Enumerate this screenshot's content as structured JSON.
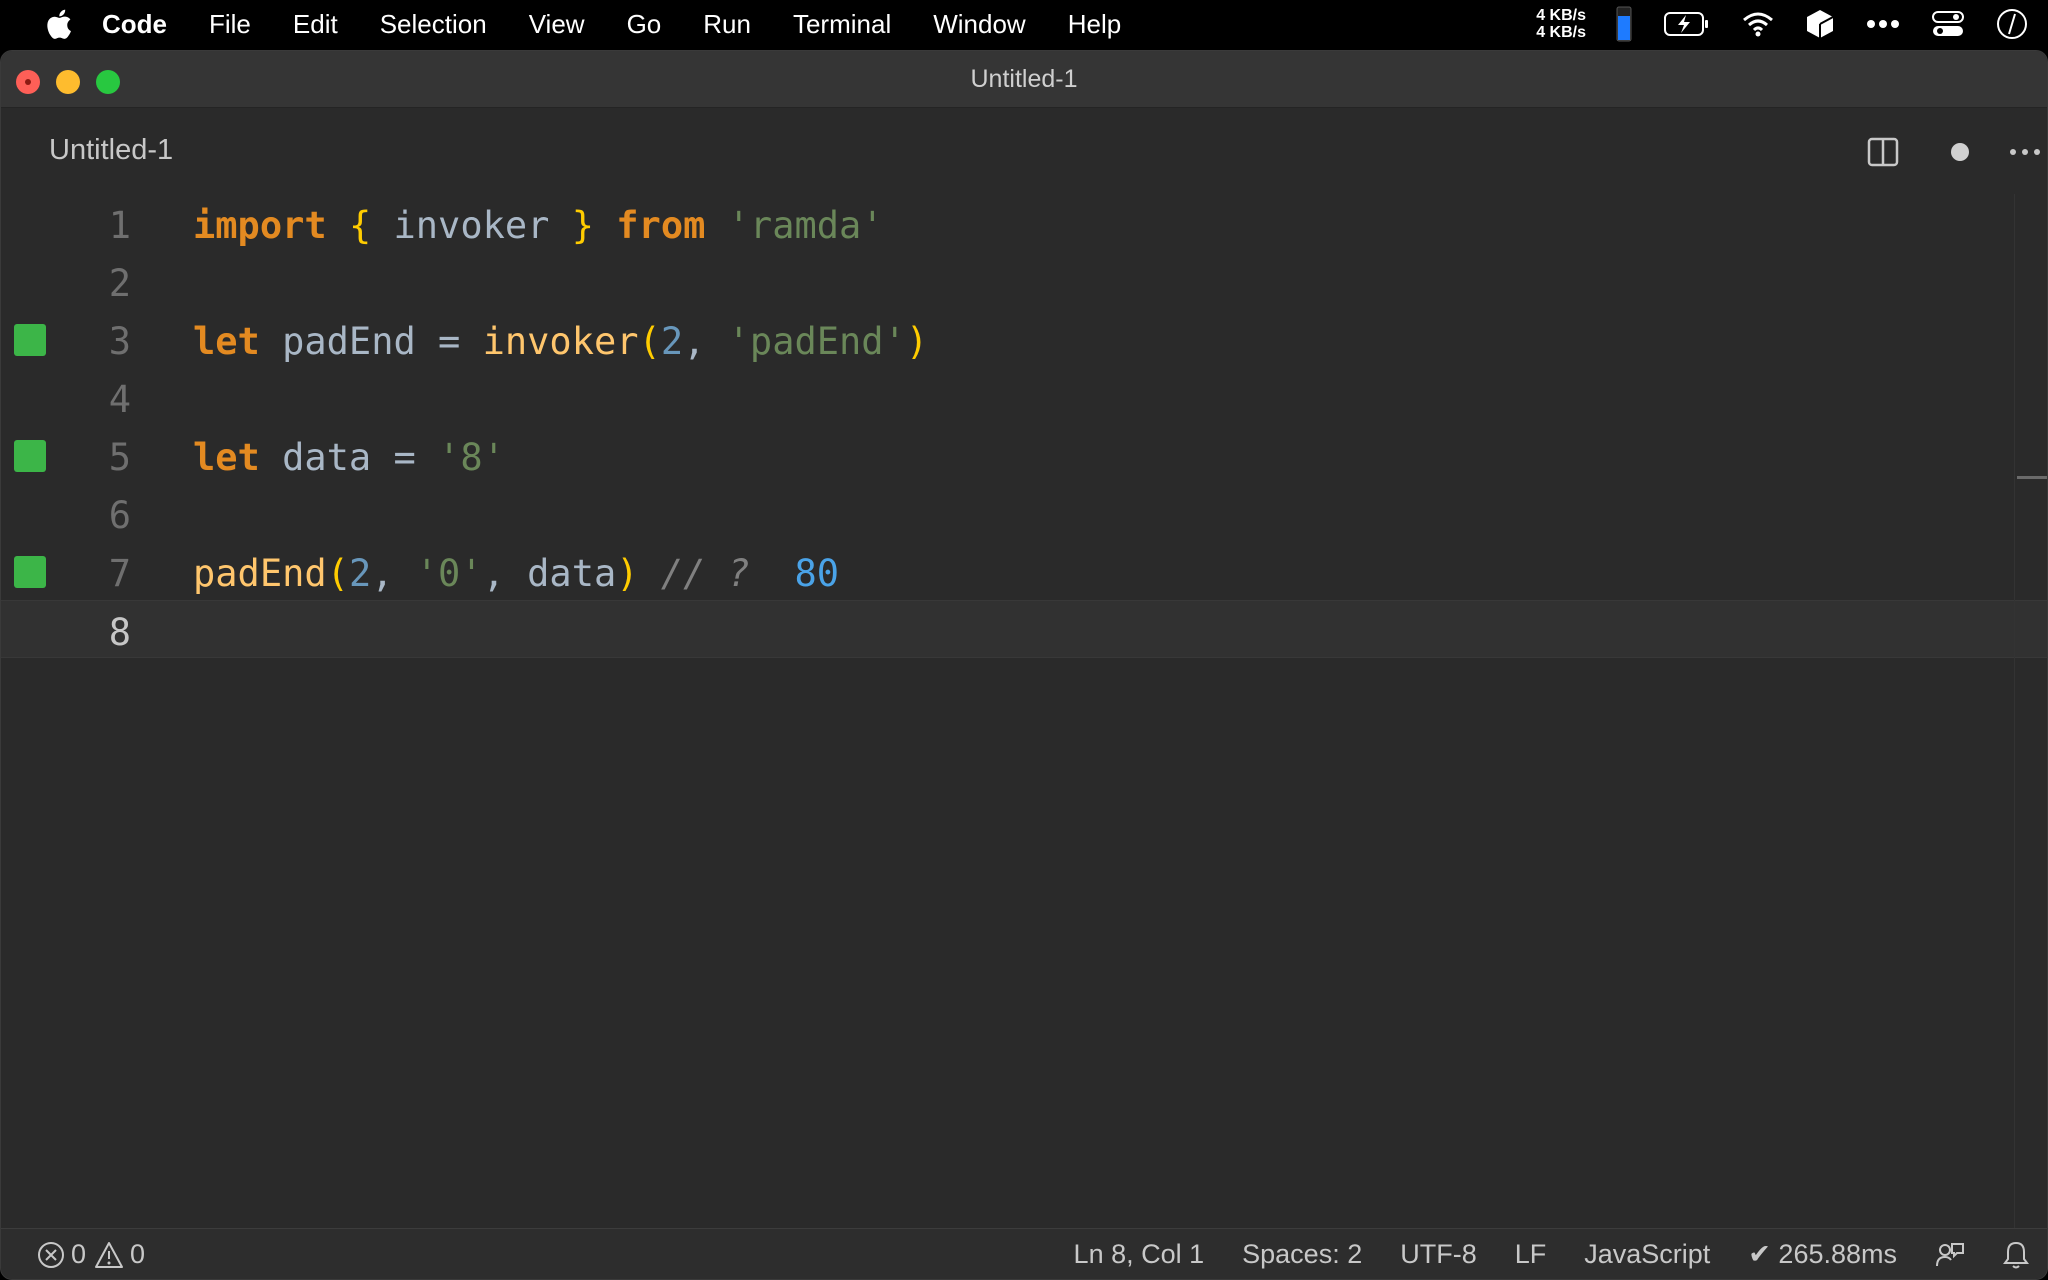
{
  "menubar": {
    "app_name": "Code",
    "items": [
      "File",
      "Edit",
      "Selection",
      "View",
      "Go",
      "Run",
      "Terminal",
      "Window",
      "Help"
    ],
    "net_up": "4 KB/s",
    "net_down": "4 KB/s"
  },
  "window": {
    "title": "Untitled-1",
    "tab_label": "Untitled-1"
  },
  "editor": {
    "line_numbers": [
      "1",
      "2",
      "3",
      "4",
      "5",
      "6",
      "7",
      "8"
    ],
    "current_line": 8,
    "lines": [
      [
        {
          "t": "import",
          "c": "kw"
        },
        {
          "t": " ",
          "c": "id"
        },
        {
          "t": "{",
          "c": "br"
        },
        {
          "t": " invoker ",
          "c": "id"
        },
        {
          "t": "}",
          "c": "br"
        },
        {
          "t": " ",
          "c": "id"
        },
        {
          "t": "from",
          "c": "kw"
        },
        {
          "t": " ",
          "c": "id"
        },
        {
          "t": "'ramda'",
          "c": "str"
        }
      ],
      [],
      [
        {
          "t": "let",
          "c": "kw"
        },
        {
          "t": " padEnd = ",
          "c": "id"
        },
        {
          "t": "invoker",
          "c": "fn"
        },
        {
          "t": "(",
          "c": "br"
        },
        {
          "t": "2",
          "c": "num"
        },
        {
          "t": ", ",
          "c": "op"
        },
        {
          "t": "'padEnd'",
          "c": "str"
        },
        {
          "t": ")",
          "c": "br"
        }
      ],
      [],
      [
        {
          "t": "let",
          "c": "kw"
        },
        {
          "t": " data = ",
          "c": "id"
        },
        {
          "t": "'8'",
          "c": "str"
        }
      ],
      [],
      [
        {
          "t": "padEnd",
          "c": "fn"
        },
        {
          "t": "(",
          "c": "br"
        },
        {
          "t": "2",
          "c": "num"
        },
        {
          "t": ", ",
          "c": "op"
        },
        {
          "t": "'0'",
          "c": "str"
        },
        {
          "t": ", data",
          "c": "id"
        },
        {
          "t": ")",
          "c": "br"
        },
        {
          "t": " ",
          "c": "id"
        },
        {
          "t": "// ?",
          "c": "cm"
        },
        {
          "t": "  ",
          "c": "id"
        },
        {
          "t": "80",
          "c": "result"
        }
      ],
      []
    ],
    "markers": [
      3,
      5,
      7
    ],
    "marker_color": "#3cb548"
  },
  "statusbar": {
    "errors": "0",
    "warnings": "0",
    "position": "Ln 8, Col 1",
    "spaces": "Spaces: 2",
    "encoding": "UTF-8",
    "eol": "LF",
    "language": "JavaScript",
    "timing": "✔ 265.88ms"
  }
}
